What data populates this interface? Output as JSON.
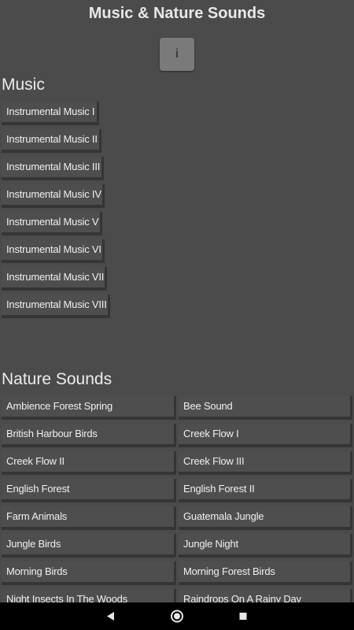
{
  "app": {
    "title": "Music & Nature Sounds",
    "info_label": "i"
  },
  "music": {
    "heading": "Music",
    "items": [
      "Instrumental Music I",
      "Instrumental Music II",
      "Instrumental Music III",
      "Instrumental Music IV",
      "Instrumental Music V",
      "Instrumental Music VI",
      "Instrumental Music VII",
      "Instrumental Music VIII"
    ]
  },
  "nature": {
    "heading": "Nature Sounds",
    "left": [
      "Ambience Forest Spring",
      "British Harbour Birds",
      "Creek Flow II",
      "English Forest",
      "Farm Animals",
      "Jungle Birds",
      "Morning Birds",
      "Night Insects In The Woods"
    ],
    "right": [
      "Bee Sound",
      "Creek Flow I",
      "Creek Flow III",
      "English Forest II",
      "Guatemala Jungle",
      "Jungle Night",
      "Morning Forest Birds",
      "Raindrops On A Rainy Day"
    ]
  },
  "nav": {
    "back_icon": "back-triangle-icon",
    "home_icon": "home-circle-icon",
    "recent_icon": "recent-square-icon"
  }
}
